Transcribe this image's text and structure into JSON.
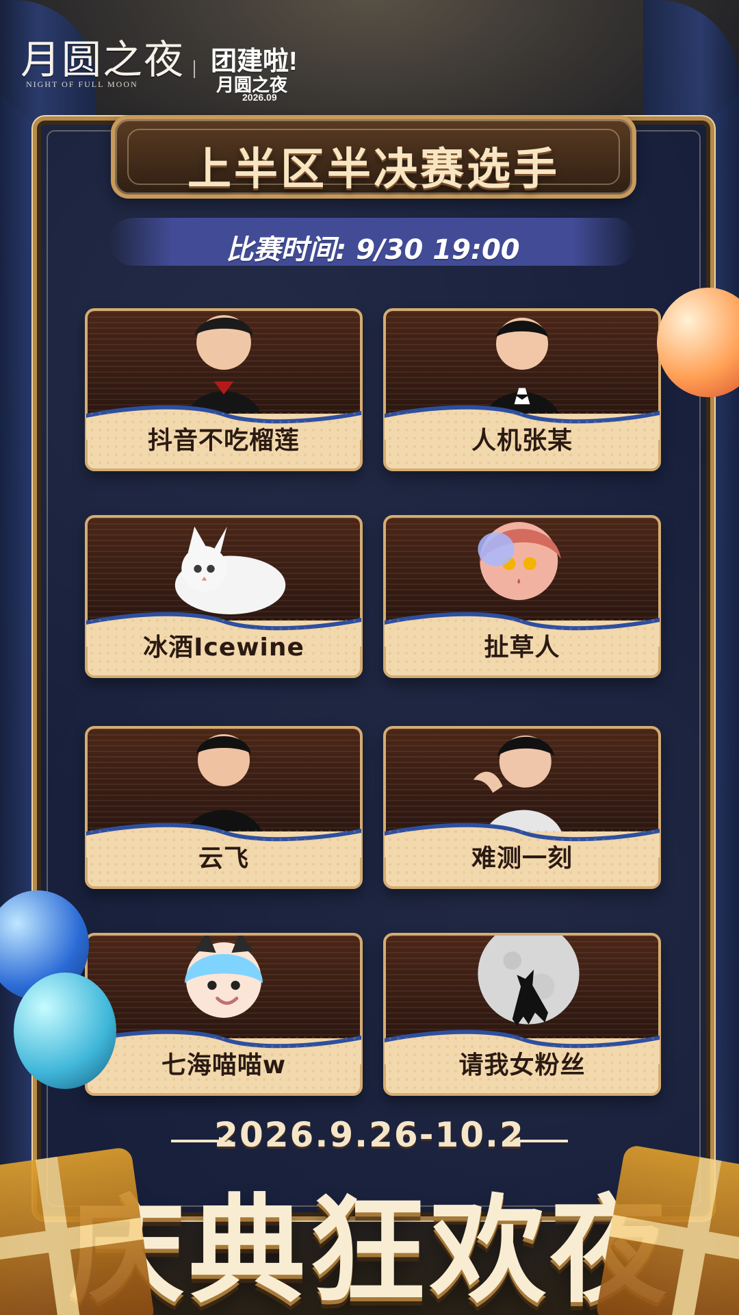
{
  "brand": {
    "logo_main": "月圆之夜",
    "logo_sub": "NIGHT OF FULL MOON",
    "event_line1": "团建啦!",
    "event_line2": "月圆之夜",
    "event_date": "2026.09"
  },
  "header": {
    "title": "上半区半决赛选手",
    "match_time": "比赛时间: 9/30 19:00"
  },
  "players": [
    {
      "name": "抖音不吃榴莲"
    },
    {
      "name": "人机张某"
    },
    {
      "name": "冰酒Icewine"
    },
    {
      "name": "扯草人"
    },
    {
      "name": "云飞"
    },
    {
      "name": "难测一刻"
    },
    {
      "name": "七海喵喵w"
    },
    {
      "name": "请我女粉丝"
    }
  ],
  "footer": {
    "date_range": "2026.9.26-10.2",
    "big_title": "庆典狂欢夜"
  },
  "colors": {
    "accent_gold": "#d5ad72",
    "card_bg": "#f2d8ad",
    "panel_bg": "#171f3b",
    "title_text": "#f8e6c2",
    "ribbon_blue": "#444e9b"
  },
  "icons": {
    "arrow_left": "arrow-left-icon",
    "arrow_right": "arrow-right-icon"
  }
}
